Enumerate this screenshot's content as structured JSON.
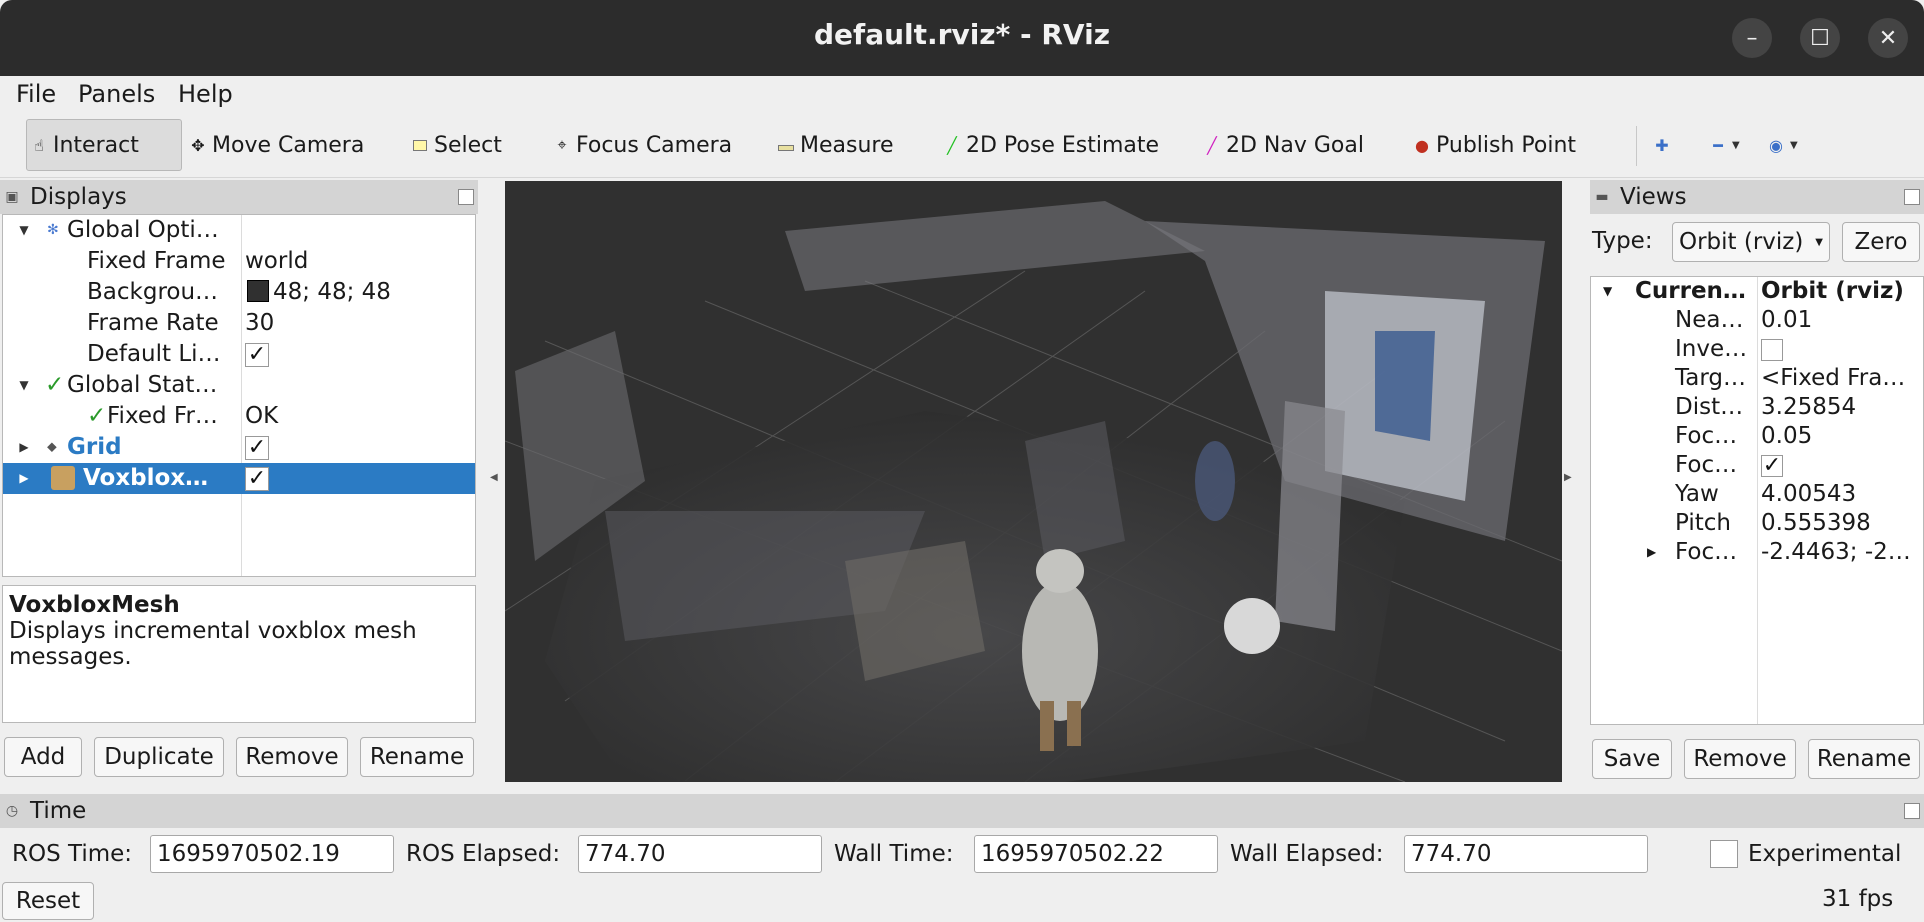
{
  "window": {
    "title": "default.rviz* - RViz",
    "minimize": "–",
    "maximize": "☐",
    "close": "✕"
  },
  "menu": {
    "file": "File",
    "panels": "Panels",
    "help": "Help"
  },
  "toolbar": {
    "interact": "Interact",
    "move_camera": "Move Camera",
    "select": "Select",
    "focus_camera": "Focus Camera",
    "measure": "Measure",
    "pose_estimate": "2D Pose Estimate",
    "nav_goal": "2D Nav Goal",
    "publish_point": "Publish Point",
    "accent_pose": "#22c022",
    "accent_nav": "#d020c0",
    "accent_point": "#c03020"
  },
  "displays": {
    "title": "Displays",
    "rows": [
      {
        "label": "Global Opti…",
        "value": ""
      },
      {
        "label": "Fixed Frame",
        "value": "world"
      },
      {
        "label": "Backgrou…",
        "value": "48; 48; 48"
      },
      {
        "label": "Frame Rate",
        "value": "30"
      },
      {
        "label": "Default Li…",
        "value": "✓"
      },
      {
        "label": "Global Stat…",
        "value": ""
      },
      {
        "label": "Fixed Fr…",
        "value": "OK"
      },
      {
        "label": "Grid",
        "value": "✓"
      },
      {
        "label": "Voxblox…",
        "value": "✓"
      }
    ],
    "check": "✓",
    "description_title": "VoxbloxMesh",
    "description_body": "Displays incremental voxblox mesh messages.",
    "buttons": {
      "add": "Add",
      "duplicate": "Duplicate",
      "remove": "Remove",
      "rename": "Rename"
    },
    "selected_color": "#2b7bc4"
  },
  "views": {
    "title": "Views",
    "type_label": "Type:",
    "type_value": "Orbit (rviz)",
    "zero": "Zero",
    "current_label": "Curren…",
    "current_value": "Orbit (rviz)",
    "rows": [
      {
        "label": "Nea…",
        "value": "0.01"
      },
      {
        "label": "Inve…",
        "value": ""
      },
      {
        "label": "Targ…",
        "value": "<Fixed Fra…"
      },
      {
        "label": "Dist…",
        "value": "3.25854"
      },
      {
        "label": "Foc…",
        "value": "0.05"
      },
      {
        "label": "Foc…",
        "value": "✓"
      },
      {
        "label": "Yaw",
        "value": "4.00543"
      },
      {
        "label": "Pitch",
        "value": "0.555398"
      },
      {
        "label": "Foc…",
        "value": "-2.4463; -2…"
      }
    ],
    "buttons": {
      "save": "Save",
      "remove": "Remove",
      "rename": "Rename"
    }
  },
  "time": {
    "title": "Time",
    "ros_time_label": "ROS Time:",
    "ros_time": "1695970502.19",
    "ros_elapsed_label": "ROS Elapsed:",
    "ros_elapsed": "774.70",
    "wall_time_label": "Wall Time:",
    "wall_time": "1695970502.22",
    "wall_elapsed_label": "Wall Elapsed:",
    "wall_elapsed": "774.70",
    "experimental": "Experimental",
    "reset": "Reset",
    "fps": "31 fps"
  }
}
